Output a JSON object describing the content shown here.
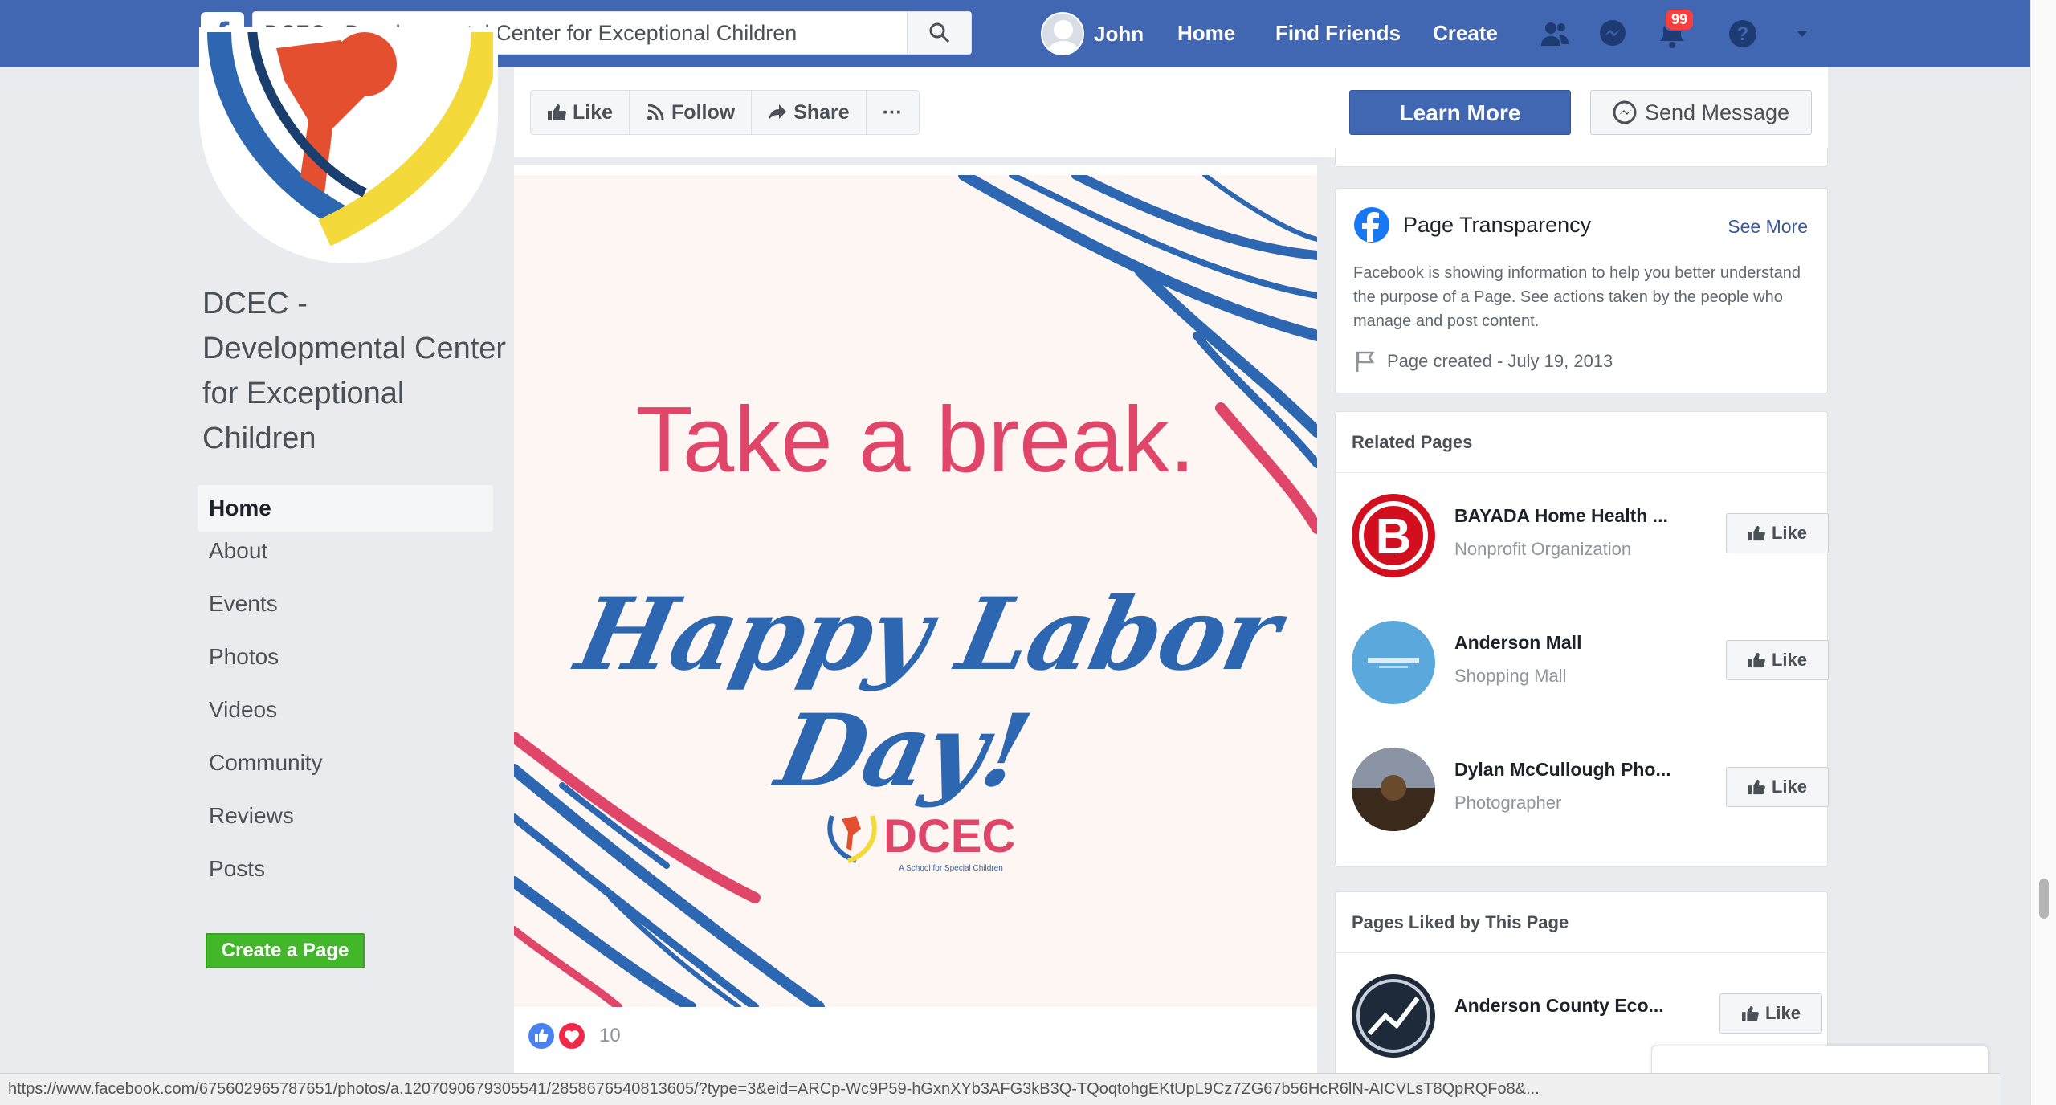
{
  "topbar": {
    "search": {
      "value": "DCEC - Developmental Center for Exceptional Children"
    },
    "user_name": "John",
    "nav_home": "Home",
    "nav_find_friends": "Find Friends",
    "nav_create": "Create",
    "notification_count": "99"
  },
  "page": {
    "title": "DCEC - Developmental Center for Exceptional Children"
  },
  "left_nav": {
    "items": [
      {
        "label": "Home"
      },
      {
        "label": "About"
      },
      {
        "label": "Events"
      },
      {
        "label": "Photos"
      },
      {
        "label": "Videos"
      },
      {
        "label": "Community"
      },
      {
        "label": "Reviews"
      },
      {
        "label": "Posts"
      }
    ],
    "create_page": "Create a Page"
  },
  "actions": {
    "like": "Like",
    "follow": "Follow",
    "share": "Share",
    "more": "···",
    "learn_more": "Learn More",
    "send_message": "Send Message"
  },
  "post": {
    "headline": "Take a break.",
    "script": "Happy Labor Day!",
    "logo_text": "DCEC",
    "logo_sub": "A School for Special Children",
    "reaction_count": "10"
  },
  "transparency": {
    "title": "Page Transparency",
    "see_more": "See More",
    "text": "Facebook is showing information to help you better understand the purpose of a Page. See actions taken by the people who manage and post content.",
    "page_created": "Page created - July 19, 2013"
  },
  "related_pages": {
    "heading": "Related Pages",
    "items": [
      {
        "name": "BAYADA Home Health ...",
        "category": "Nonprofit Organization",
        "like": "Like"
      },
      {
        "name": "Anderson Mall",
        "category": "Shopping Mall",
        "like": "Like"
      },
      {
        "name": "Dylan McCullough Pho...",
        "category": "Photographer",
        "like": "Like"
      }
    ]
  },
  "pages_liked": {
    "heading": "Pages Liked by This Page",
    "items": [
      {
        "name": "Anderson County Eco...",
        "like": "Like"
      }
    ]
  },
  "status_bar": {
    "url": "https://www.facebook.com/675602965787651/photos/a.1207090679305541/2858676540813605/?type=3&eid=ARCp-Wc9P59-hGxnXYb3AFG3kB3Q-TQoqtohgEKtUpL9Cz7ZG67b56HcR6lN-AICVLsT8QpRQFo8&..."
  },
  "colors": {
    "brand": "#4267b2",
    "headline": "#e0456a",
    "script": "#2e67b1",
    "create_page": "#42b72a"
  }
}
